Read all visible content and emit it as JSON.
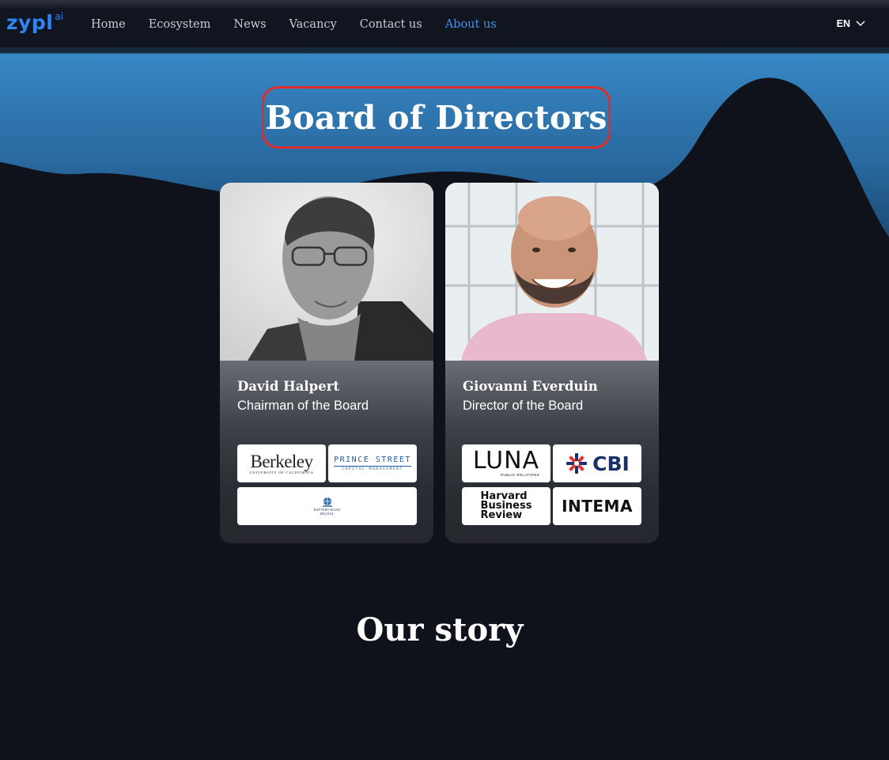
{
  "nav": {
    "logo": "zypl",
    "logo_sup": "ai",
    "items": [
      {
        "label": "Home"
      },
      {
        "label": "Ecosystem"
      },
      {
        "label": "News"
      },
      {
        "label": "Vacancy"
      },
      {
        "label": "Contact us"
      },
      {
        "label": "About us",
        "active": true
      }
    ],
    "language": "EN",
    "language_icon": "chevron-down-icon"
  },
  "board": {
    "title": "Board of Directors",
    "members": [
      {
        "name": "David Halpert",
        "role": "Chairman of the Board",
        "logos": [
          {
            "name": "Berkeley",
            "text": "Berkeley",
            "sub": "UNIVERSITY OF CALIFORNIA"
          },
          {
            "name": "Prince Street Capital Management",
            "text": "PRINCE STREET",
            "sub": "CAPITAL MANAGEMENT"
          },
          {
            "name": "Battery Road Digital",
            "text": "BATTERY ROAD",
            "sub": "DIGITAL"
          }
        ]
      },
      {
        "name": "Giovanni Everduin",
        "role": "Director of the Board",
        "logos": [
          {
            "name": "Luna Public Relations",
            "text": "LUNA",
            "sub": "PUBLIC RELATIONS"
          },
          {
            "name": "CBI",
            "text": "CBI"
          },
          {
            "name": "Harvard Business Review",
            "lines": [
              "Harvard",
              "Business",
              "Review"
            ]
          },
          {
            "name": "INTEMA",
            "text": "INTEMA"
          }
        ]
      }
    ]
  },
  "story": {
    "title": "Our story"
  },
  "colors": {
    "background": "#0f121b",
    "wave_blue": "#2f86c6",
    "accent": "#3b93ec",
    "title_border": "#e02c2a"
  }
}
